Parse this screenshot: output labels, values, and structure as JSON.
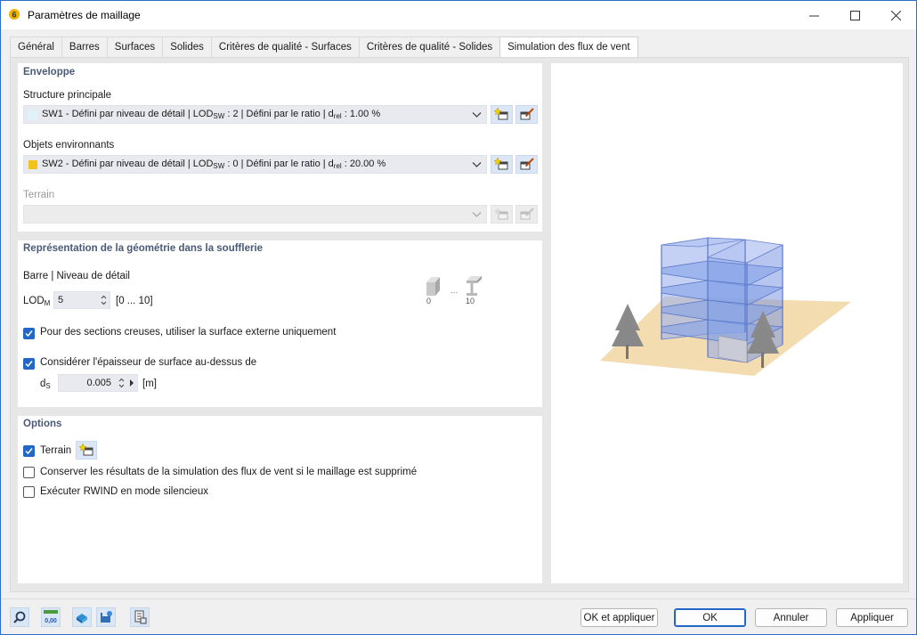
{
  "window": {
    "title": "Paramètres de maillage"
  },
  "tabs": [
    {
      "label": "Général",
      "active": false
    },
    {
      "label": "Barres",
      "active": false
    },
    {
      "label": "Surfaces",
      "active": false
    },
    {
      "label": "Solides",
      "active": false
    },
    {
      "label": "Critères de qualité - Surfaces",
      "active": false
    },
    {
      "label": "Critères de qualité - Solides",
      "active": false
    },
    {
      "label": "Simulation des flux de vent",
      "active": true
    }
  ],
  "envelope": {
    "title": "Enveloppe",
    "main_structure_label": "Structure principale",
    "main_structure": {
      "pre": "SW1 - Défini par niveau de détail | LOD",
      "sub": "SW",
      "mid": " : 2 | Défini par le ratio | d",
      "sub2": "rel",
      "post": " : 1.00 %",
      "color": "#dff3fb"
    },
    "surrounding_label": "Objets environnants",
    "surrounding": {
      "pre": "SW2 - Défini par niveau de détail | LOD",
      "sub": "SW",
      "mid": " : 0 | Défini par le ratio | d",
      "sub2": "rel",
      "post": " : 20.00 %",
      "color": "#f2c318"
    },
    "terrain_label": "Terrain",
    "terrain_value": ""
  },
  "geometry": {
    "title": "Représentation de la géométrie dans la soufflerie",
    "bar_detail_label": "Barre | Niveau de détail",
    "lod_label": "LOD",
    "lod_sub": "M",
    "lod_value": "5",
    "lod_range": "[0 ... 10]",
    "lod_img_min": "0",
    "lod_img_dots": "...",
    "lod_img_max": "10",
    "hollow_sections_label": "Pour des sections creuses, utiliser la surface externe uniquement",
    "hollow_sections_checked": true,
    "thickness_label": "Considérer l'épaisseur de surface au-dessus de",
    "thickness_checked": true,
    "ds_label": "d",
    "ds_sub": "S",
    "ds_value": "0.005",
    "ds_unit": "[m]"
  },
  "options": {
    "title": "Options",
    "terrain_label": "Terrain",
    "terrain_checked": true,
    "keep_results_label": "Conserver les résultats de la simulation des flux de vent si le maillage est supprimé",
    "keep_results_checked": false,
    "silent_label": "Exécuter RWIND en mode silencieux",
    "silent_checked": false
  },
  "footer": {
    "units_icon_text": "0,00",
    "ok_apply": "OK et appliquer",
    "ok": "OK",
    "cancel": "Annuler",
    "apply": "Appliquer"
  },
  "colors": {
    "accent": "#2266c6",
    "section_title": "#4a5a78",
    "building": "#7f9ee8",
    "ground": "#f2dcb0",
    "tree": "#8a8a8a"
  }
}
